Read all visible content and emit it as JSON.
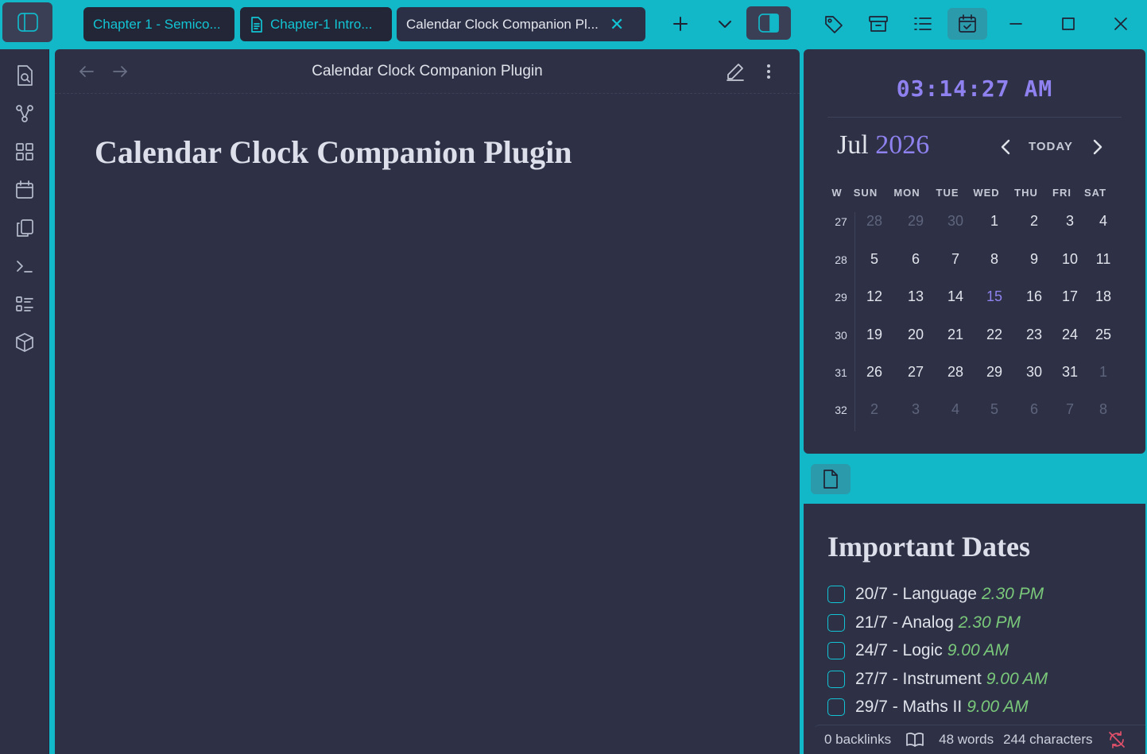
{
  "tabs": [
    {
      "label": "Chapter 1 - Semico..."
    },
    {
      "label": "Chapter-1 Intro..."
    },
    {
      "label": "Calendar Clock Companion Pl..."
    }
  ],
  "editor": {
    "header_title": "Calendar Clock Companion Plugin",
    "doc_title": "Calendar Clock Companion Plugin"
  },
  "calendar": {
    "time": "03:14:27 AM",
    "month": "Jul",
    "year": "2026",
    "today_label": "TODAY",
    "weekdays": [
      "W",
      "SUN",
      "MON",
      "TUE",
      "WED",
      "THU",
      "FRI",
      "SAT"
    ],
    "weeks": [
      {
        "num": "27",
        "days": [
          "28",
          "29",
          "30",
          "1",
          "2",
          "3",
          "4"
        ],
        "muted": [
          0,
          1,
          2
        ]
      },
      {
        "num": "28",
        "days": [
          "5",
          "6",
          "7",
          "8",
          "9",
          "10",
          "11"
        ],
        "muted": []
      },
      {
        "num": "29",
        "days": [
          "12",
          "13",
          "14",
          "15",
          "16",
          "17",
          "18"
        ],
        "muted": [],
        "today": 3
      },
      {
        "num": "30",
        "days": [
          "19",
          "20",
          "21",
          "22",
          "23",
          "24",
          "25"
        ],
        "muted": []
      },
      {
        "num": "31",
        "days": [
          "26",
          "27",
          "28",
          "29",
          "30",
          "31",
          "1"
        ],
        "muted": [
          6
        ]
      },
      {
        "num": "32",
        "days": [
          "2",
          "3",
          "4",
          "5",
          "6",
          "7",
          "8"
        ],
        "muted": [
          0,
          1,
          2,
          3,
          4,
          5,
          6
        ]
      }
    ]
  },
  "note": {
    "title": "Important Dates",
    "tasks": [
      {
        "text": "20/7 - Language",
        "time": "2.30 PM"
      },
      {
        "text": "21/7 - Analog",
        "time": "2.30 PM"
      },
      {
        "text": "24/7 - Logic",
        "time": "9.00 AM"
      },
      {
        "text": "27/7 - Instrument",
        "time": "9.00 AM"
      },
      {
        "text": "29/7 - Maths II",
        "time": "9.00 AM"
      }
    ]
  },
  "status": {
    "backlinks": "0 backlinks",
    "words": "48 words",
    "characters": "244 characters"
  },
  "colors": {
    "accent": "#12b8c8",
    "purple": "#8f82f0",
    "panel": "#2e3146",
    "time_green": "#7ac97a"
  }
}
